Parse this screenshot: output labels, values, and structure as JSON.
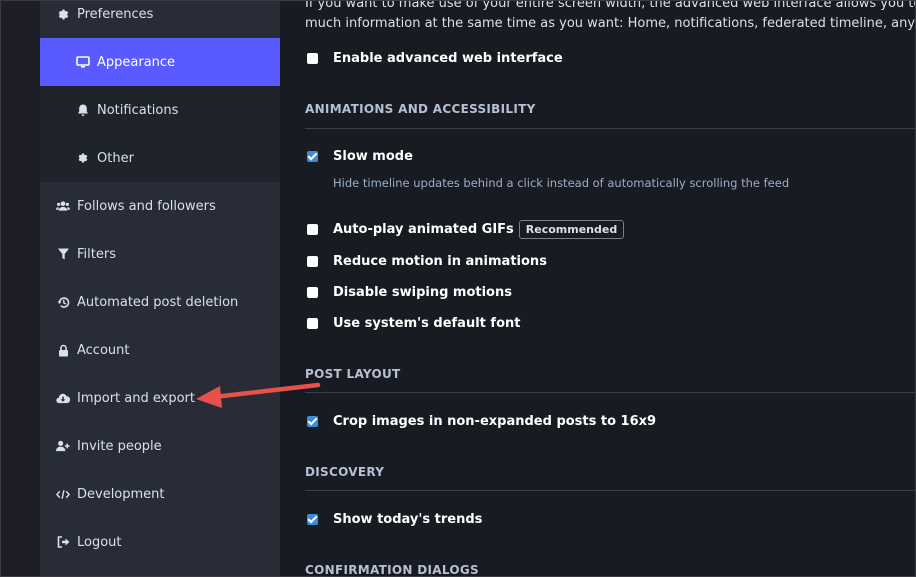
{
  "sidebar": {
    "items": [
      {
        "label": "Preferences",
        "icon": "gear-icon"
      },
      {
        "label": "Appearance",
        "icon": "desktop-icon"
      },
      {
        "label": "Notifications",
        "icon": "bell-icon"
      },
      {
        "label": "Other",
        "icon": "gear-icon"
      },
      {
        "label": "Follows and followers",
        "icon": "users-icon"
      },
      {
        "label": "Filters",
        "icon": "filter-icon"
      },
      {
        "label": "Automated post deletion",
        "icon": "history-icon"
      },
      {
        "label": "Account",
        "icon": "lock-icon"
      },
      {
        "label": "Import and export",
        "icon": "cloud-download-icon"
      },
      {
        "label": "Invite people",
        "icon": "user-plus-icon"
      },
      {
        "label": "Development",
        "icon": "code-icon"
      },
      {
        "label": "Logout",
        "icon": "sign-out-icon"
      }
    ],
    "active_item": "Appearance"
  },
  "main": {
    "intro_line1": "If you want to make use of your entire screen width, the advanced web interface allows you to configure m",
    "intro_line2": "much information at the same time as you want: Home, notifications, federated timeline, any number of lis",
    "advanced_web_interface": {
      "label": "Enable advanced web interface",
      "checked": false
    },
    "sections": {
      "animations": "ANIMATIONS AND ACCESSIBILITY",
      "post_layout": "POST LAYOUT",
      "discovery": "DISCOVERY",
      "confirmation": "CONFIRMATION DIALOGS"
    },
    "slow_mode": {
      "label": "Slow mode",
      "checked": true,
      "hint": "Hide timeline updates behind a click instead of automatically scrolling the feed"
    },
    "autoplay_gifs": {
      "label": "Auto-play animated GIFs",
      "checked": false,
      "badge": "Recommended"
    },
    "reduce_motion": {
      "label": "Reduce motion in animations",
      "checked": false
    },
    "disable_swiping": {
      "label": "Disable swiping motions",
      "checked": false
    },
    "system_font": {
      "label": "Use system's default font",
      "checked": false
    },
    "crop_images": {
      "label": "Crop images in non-expanded posts to 16x9",
      "checked": true
    },
    "show_trends": {
      "label": "Show today's trends",
      "checked": true
    }
  },
  "colors": {
    "accent": "#595aff",
    "checkbox_checked": "#3b8bd9",
    "arrow": "#e8504a"
  }
}
